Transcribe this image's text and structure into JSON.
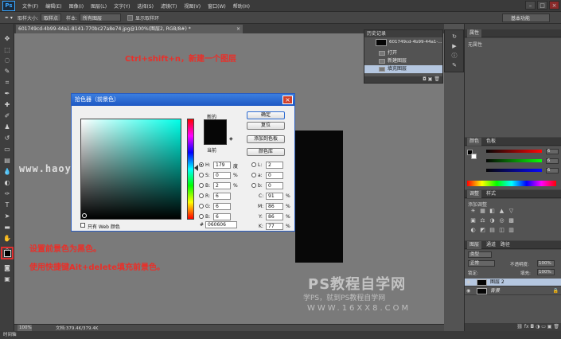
{
  "menubar": {
    "logo": "Ps",
    "items": [
      "文件(F)",
      "编辑(E)",
      "图像(I)",
      "图层(L)",
      "文字(Y)",
      "选择(S)",
      "滤镜(T)",
      "视图(V)",
      "窗口(W)",
      "帮助(H)"
    ],
    "controls": [
      "–",
      "□",
      "×"
    ]
  },
  "options": {
    "sample_size_label": "取样大小:",
    "sample_size_value": "取样点",
    "sample_label": "样本:",
    "sample_value": "所有图层",
    "show_ring_label": "显示取样环",
    "workspace": "基本功能"
  },
  "document": {
    "tab_title": "601749cd-4b99-44a1-8141-770bc27a8e74.jpg@100%(图层2, RGB/8#) *",
    "tab_close": "×",
    "zoom": "100%",
    "doc_info": "文档:379.4K/379.4K",
    "bottom_label": "时间轴"
  },
  "annotations": {
    "shortcut_new_layer": "Ctrl+shift+n，新建一个图层",
    "set_foreground": "设置前景色为黑色。",
    "fill_shortcut": "使用快捷键Ait+delete填充前景色。"
  },
  "watermarks": {
    "url_top": "www.haoyidianshejr",
    "title": "PS教程自学网",
    "subtitle": "学PS，就到PS教程自学网",
    "url_bottom": "WWW.16XX8.COM"
  },
  "color_picker": {
    "title": "拾色器（前景色）",
    "close": "×",
    "new_label": "新的",
    "current_label": "当前",
    "buttons": {
      "ok": "确定",
      "reset": "复位",
      "add_swatch": "添加到色板",
      "libraries": "颜色库"
    },
    "fields": {
      "H": {
        "label": "H:",
        "value": "179",
        "unit": "度"
      },
      "S": {
        "label": "S:",
        "value": "0",
        "unit": "%"
      },
      "B": {
        "label": "B:",
        "value": "2",
        "unit": "%"
      },
      "R": {
        "label": "R:",
        "value": "6",
        "unit": ""
      },
      "G": {
        "label": "G:",
        "value": "6",
        "unit": ""
      },
      "Bv": {
        "label": "B:",
        "value": "6",
        "unit": ""
      },
      "L": {
        "label": "L:",
        "value": "2",
        "unit": ""
      },
      "a": {
        "label": "a:",
        "value": "0",
        "unit": ""
      },
      "b": {
        "label": "b:",
        "value": "0",
        "unit": ""
      },
      "C": {
        "label": "C:",
        "value": "91",
        "unit": "%"
      },
      "M": {
        "label": "M:",
        "value": "86",
        "unit": "%"
      },
      "Y": {
        "label": "Y:",
        "value": "86",
        "unit": "%"
      },
      "K": {
        "label": "K:",
        "value": "77",
        "unit": "%"
      }
    },
    "hex_label": "#",
    "hex_value": "060606",
    "web_only_label": "只有 Web 颜色",
    "selected_color": "#060606"
  },
  "history": {
    "title": "历史记录",
    "snapshot_label": "601749cd-4b99-44a1-...",
    "items": [
      "打开",
      "新建图层",
      "填充图层"
    ],
    "footer_icons": "◘ ▣ 🗑"
  },
  "properties": {
    "title": "属性",
    "body": "无属性"
  },
  "color_panel": {
    "tabs": [
      "颜色",
      "色板"
    ],
    "values": [
      "6",
      "6",
      "6"
    ]
  },
  "adjustments": {
    "tabs": [
      "调整",
      "样式"
    ],
    "add_label": "添加调整",
    "icons_row1": [
      "☀",
      "▦",
      "◧",
      "▲",
      "▽"
    ],
    "icons_row2": [
      "▣",
      "⚖",
      "◑",
      "◎",
      "▩"
    ],
    "icons_row3": [
      "◐",
      "◩",
      "▤",
      "◫",
      "▥"
    ]
  },
  "layers": {
    "tabs": [
      "图层",
      "通道",
      "路径"
    ],
    "kind_label": "类型",
    "blend_mode": "正常",
    "opacity_label": "不透明度:",
    "opacity_value": "100%",
    "lock_label": "锁定:",
    "fill_label": "填充:",
    "fill_value": "100%",
    "items": [
      {
        "name": "图层 2",
        "selected": true
      },
      {
        "name": "背景",
        "selected": false
      }
    ]
  }
}
